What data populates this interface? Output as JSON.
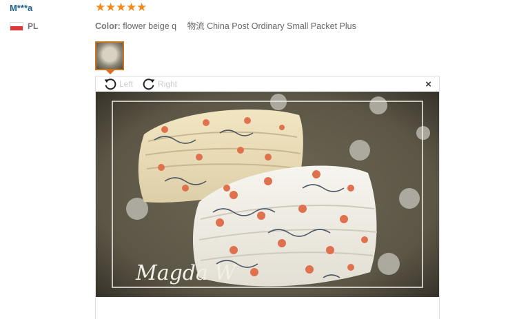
{
  "review": {
    "buyer_name": "M***a",
    "country_code": "PL",
    "rating": 5,
    "rating_stars": [
      "★",
      "★",
      "★",
      "★",
      "★"
    ],
    "color_label": "Color:",
    "color_value": "flower beige q",
    "shipping_label": "物流",
    "shipping_value": "China Post Ordinary Small Packet Plus"
  },
  "viewer": {
    "rotate_left_label": "Left",
    "rotate_right_label": "Right",
    "close_label": "×",
    "watermark": "Magda W"
  },
  "colors": {
    "star": "#f08a1c",
    "name": "#1d5f8f",
    "thumb_border": "#c97520"
  }
}
